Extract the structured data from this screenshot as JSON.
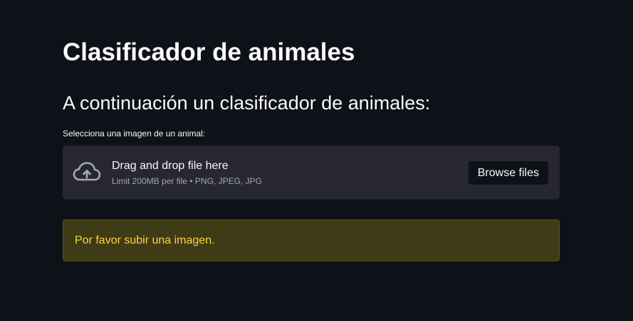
{
  "page": {
    "title": "Clasificador de animales",
    "subtitle": "A continuación un clasificador de animales:"
  },
  "uploader": {
    "label": "Selecciona una imagen de un animal:",
    "icon": "cloud-upload-icon",
    "instruction": "Drag and drop file here",
    "limit": "Limit 200MB per file • PNG, JPEG, JPG",
    "browse_label": "Browse files"
  },
  "alert": {
    "text": "Por favor subir una imagen.",
    "color": "#ffd33f",
    "background": "#3e3b16"
  },
  "colors": {
    "background": "#0e1117",
    "dropzone": "#262730",
    "text": "#fafafa"
  }
}
